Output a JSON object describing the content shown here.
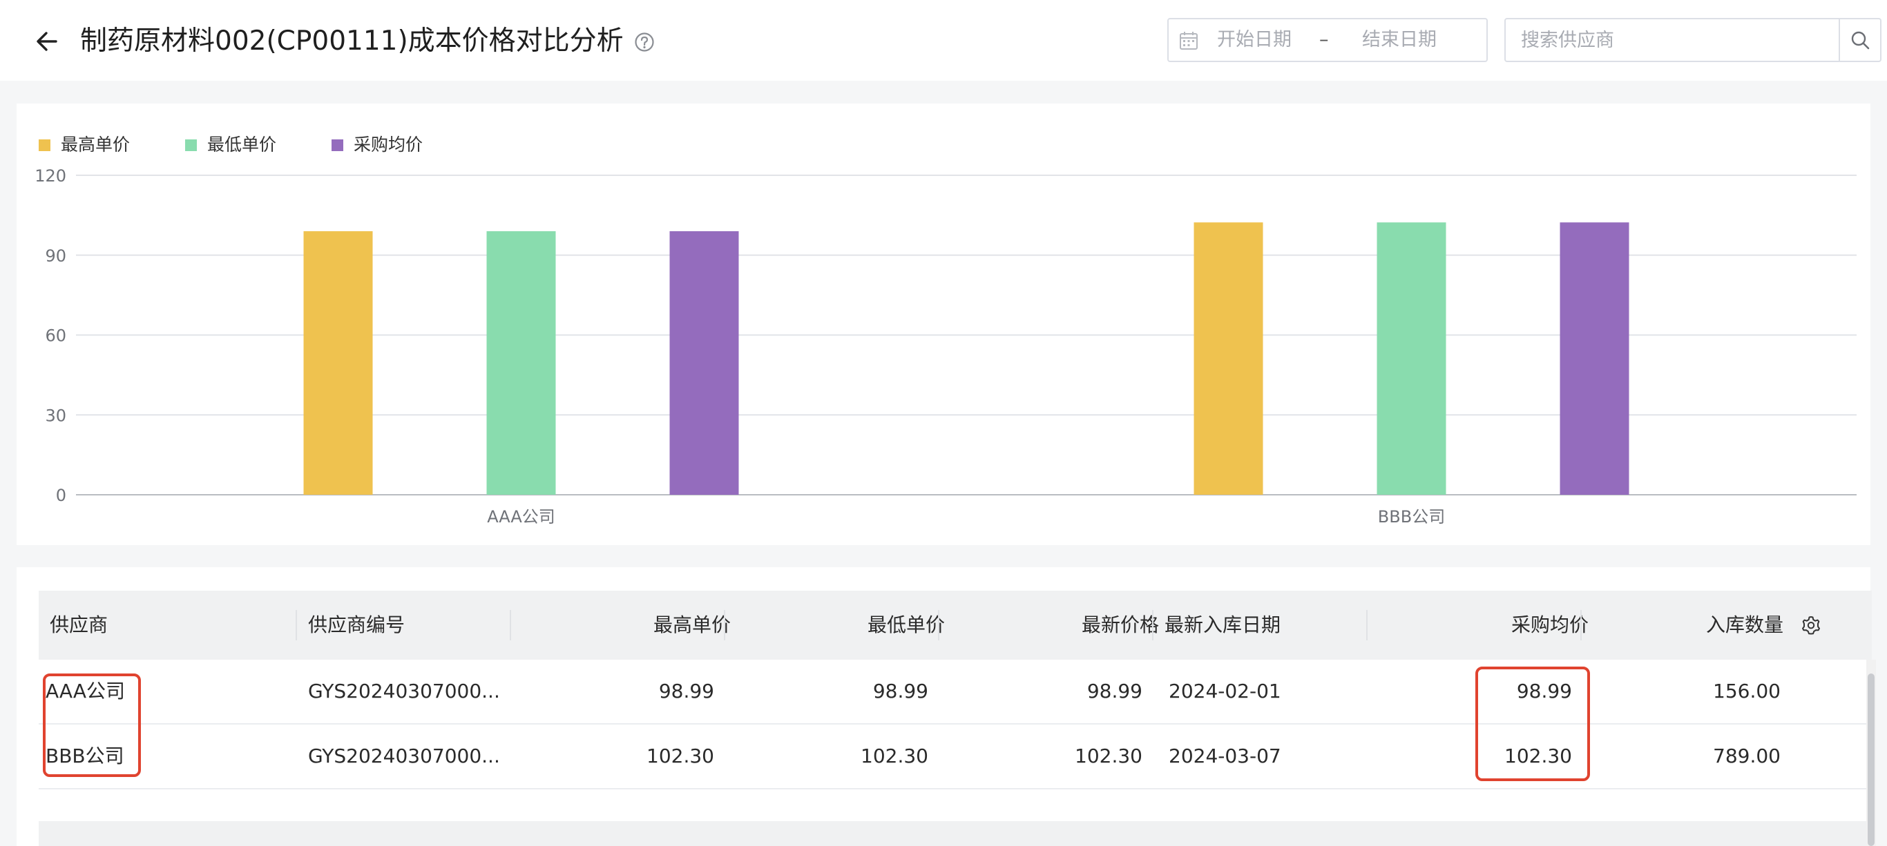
{
  "header": {
    "title": "制药原材料002(CP00111)成本价格对比分析",
    "back_icon": "arrow-left-icon",
    "help_icon": "question-circle-icon",
    "date_range": {
      "start_placeholder": "开始日期",
      "separator": "–",
      "end_placeholder": "结束日期"
    },
    "search": {
      "placeholder": "搜索供应商",
      "value": ""
    }
  },
  "chart_data": {
    "type": "bar",
    "categories": [
      "AAA公司",
      "BBB公司"
    ],
    "series": [
      {
        "name": "最高单价",
        "color": "#efc24f",
        "values": [
          98.99,
          102.3
        ]
      },
      {
        "name": "最低单价",
        "color": "#89dcae",
        "values": [
          98.99,
          102.3
        ]
      },
      {
        "name": "采购均价",
        "color": "#946cbd",
        "values": [
          98.99,
          102.3
        ]
      }
    ],
    "yticks": [
      0,
      30,
      60,
      90,
      120
    ],
    "ylim": [
      0,
      120
    ],
    "grid": true,
    "legend": "top-left"
  },
  "table": {
    "columns": [
      "供应商",
      "供应商编号",
      "最高单价",
      "最低单价",
      "最新价格",
      "最新入库日期",
      "采购均价",
      "入库数量"
    ],
    "rows": [
      {
        "supplier": "AAA公司",
        "code": "GYS20240307000...",
        "max_price": "98.99",
        "min_price": "98.99",
        "latest_price": "98.99",
        "latest_date": "2024-02-01",
        "avg_price": "98.99",
        "qty": "156.00"
      },
      {
        "supplier": "BBB公司",
        "code": "GYS20240307000...",
        "max_price": "102.30",
        "min_price": "102.30",
        "latest_price": "102.30",
        "latest_date": "2024-03-07",
        "avg_price": "102.30",
        "qty": "789.00"
      }
    ],
    "settings_icon": "gear-icon"
  },
  "colors": {
    "highlight": "#e0432f"
  }
}
